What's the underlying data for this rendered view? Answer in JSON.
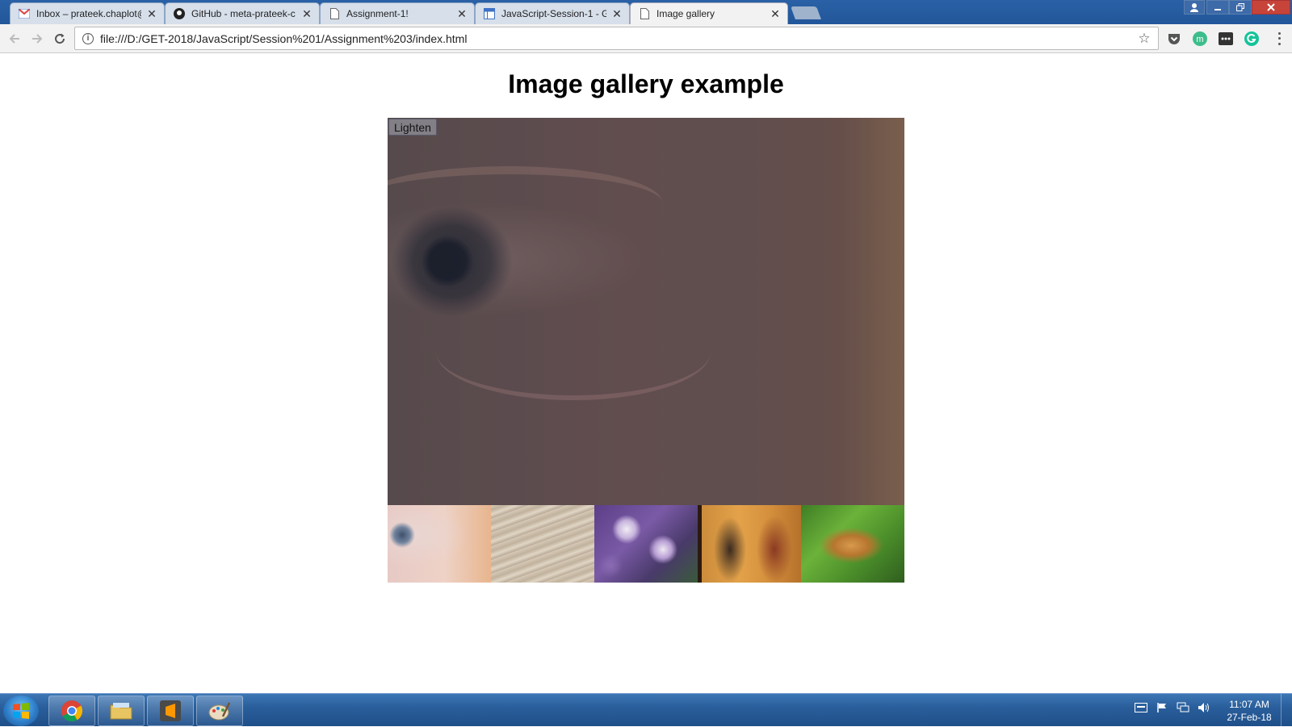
{
  "browser": {
    "tabs": [
      {
        "title": "Inbox – prateek.chaplot@",
        "icon": "gmail-icon"
      },
      {
        "title": "GitHub - meta-prateek-c",
        "icon": "github-icon"
      },
      {
        "title": "Assignment-1!",
        "icon": "page-icon"
      },
      {
        "title": "JavaScript-Session-1 - Gl",
        "icon": "docs-icon"
      },
      {
        "title": "Image gallery",
        "icon": "page-icon",
        "active": true
      }
    ],
    "url": "file:///D:/GET-2018/JavaScript/Session%201/Assignment%203/index.html",
    "info_glyph": "i",
    "extensions": [
      "pocket-icon",
      "m-extension-icon",
      "ellipsis-extension-icon",
      "grammarly-icon"
    ]
  },
  "page": {
    "title": "Image gallery example",
    "lighten_label": "Lighten",
    "main_image": "eye-closeup",
    "thumbnails": [
      "eye",
      "rock",
      "flowers",
      "egyptian-painting",
      "butterfly"
    ]
  },
  "taskbar": {
    "apps": [
      "chrome-icon",
      "explorer-icon",
      "sublime-text-icon",
      "paint-icon"
    ],
    "clock_time": "11:07 AM",
    "clock_date": "27-Feb-18"
  }
}
